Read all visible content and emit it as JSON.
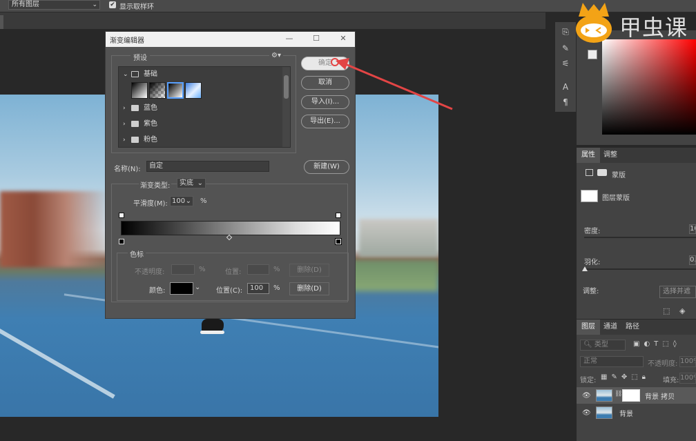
{
  "options_bar": {
    "layer_select": "所有图层",
    "show_sampling_ring": "显示取样环"
  },
  "dialog": {
    "title": "渐变编辑器",
    "presets_label": "预设",
    "folders": [
      {
        "name": "基础",
        "expanded": true
      },
      {
        "name": "蓝色",
        "expanded": false
      },
      {
        "name": "紫色",
        "expanded": false
      },
      {
        "name": "粉色",
        "expanded": false
      }
    ],
    "buttons": {
      "ok": "确定",
      "cancel": "取消",
      "import": "导入(I)...",
      "export": "导出(E)...",
      "new": "新建(W)"
    },
    "name_label": "名称(N):",
    "name_value": "自定",
    "gradient_type_label": "渐变类型:",
    "gradient_type_value": "实底",
    "smoothness_label": "平滑度(M):",
    "smoothness_value": "100",
    "smoothness_unit": "%",
    "color_stops_label": "色标",
    "opacity_label": "不透明度:",
    "opacity_unit": "%",
    "location_label_dim": "位置:",
    "location_unit_dim": "%",
    "delete_dim": "删除(D)",
    "color_label": "颜色:",
    "location_label": "位置(C):",
    "location_value": "100",
    "location_unit": "%",
    "delete": "删除(D)"
  },
  "watermark": {
    "brand_text": "甲虫课"
  },
  "properties_panel": {
    "tabs": [
      "属性",
      "调整"
    ],
    "section_title": "蒙版",
    "mask_label": "图层蒙版",
    "density_label": "密度:",
    "density_value": "10",
    "feather_label": "羽化:",
    "feather_value": "0.",
    "adjust_label": "调整:",
    "select_button": "选择并遮"
  },
  "layers_panel": {
    "tabs": [
      "图层",
      "通道",
      "路径"
    ],
    "filter_placeholder": "类型",
    "blend_mode": "正常",
    "opacity_label": "不透明度:",
    "opacity_value": "100%",
    "lock_label": "锁定:",
    "fill_label": "填充:",
    "fill_value": "100%",
    "layers": [
      {
        "name": "背景 拷贝",
        "selected": true,
        "has_mask": true
      },
      {
        "name": "背景",
        "selected": false,
        "has_mask": false
      }
    ]
  },
  "colors": {
    "accent_red": "#e34545",
    "dialog_bg": "#535353",
    "panel_bg": "#434343"
  }
}
